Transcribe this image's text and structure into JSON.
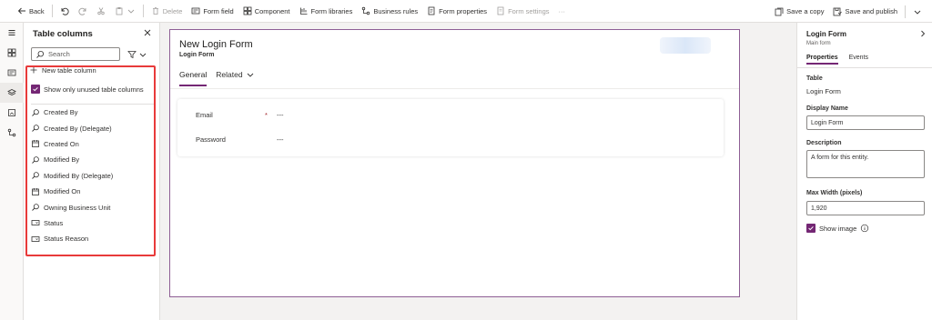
{
  "toolbar": {
    "back": "Back",
    "delete": "Delete",
    "form_field": "Form field",
    "component": "Component",
    "form_libraries": "Form libraries",
    "business_rules": "Business rules",
    "form_properties": "Form properties",
    "form_settings": "Form settings",
    "more": "···",
    "save_copy": "Save a copy",
    "save_publish": "Save and publish"
  },
  "columns_panel": {
    "title": "Table columns",
    "search_placeholder": "Search",
    "new_column": "New table column",
    "show_unused": "Show only unused table columns",
    "items": [
      {
        "label": "Created By",
        "icon": "lookup-icon"
      },
      {
        "label": "Created By (Delegate)",
        "icon": "lookup-icon"
      },
      {
        "label": "Created On",
        "icon": "calendar-icon"
      },
      {
        "label": "Modified By",
        "icon": "lookup-icon"
      },
      {
        "label": "Modified By (Delegate)",
        "icon": "lookup-icon"
      },
      {
        "label": "Modified On",
        "icon": "calendar-icon"
      },
      {
        "label": "Owning Business Unit",
        "icon": "lookup-icon"
      },
      {
        "label": "Status",
        "icon": "option-set-icon"
      },
      {
        "label": "Status Reason",
        "icon": "option-set-icon"
      }
    ]
  },
  "form": {
    "title": "New Login Form",
    "subtitle": "Login Form",
    "tabs": [
      {
        "label": "General"
      },
      {
        "label": "Related"
      }
    ],
    "fields": [
      {
        "label": "Email",
        "required": "*",
        "value": "---"
      },
      {
        "label": "Password",
        "required": "",
        "value": "---"
      }
    ]
  },
  "properties": {
    "title": "Login Form",
    "subtitle": "Main form",
    "tab_properties": "Properties",
    "tab_events": "Events",
    "table_label": "Table",
    "table_value": "Login Form",
    "display_name_label": "Display Name",
    "display_name_value": "Login Form",
    "description_label": "Description",
    "description_value": "A form for this entity.",
    "max_width_label": "Max Width (pixels)",
    "max_width_value": "1,920",
    "show_image": "Show image"
  },
  "colors": {
    "accent": "#742774",
    "highlight": "#e83a3a",
    "canvas_border": "#8e5e95"
  }
}
